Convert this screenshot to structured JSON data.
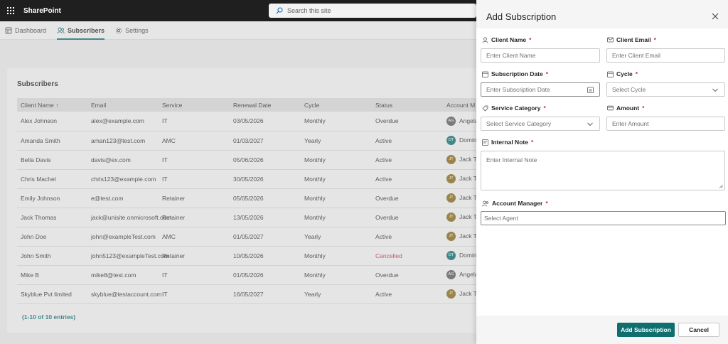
{
  "suite": {
    "brand": "SharePoint",
    "search_placeholder": "Search this site"
  },
  "nav": {
    "items": [
      {
        "label": "Dashboard"
      },
      {
        "label": "Subscribers"
      },
      {
        "label": "Settings"
      }
    ]
  },
  "subscribers": {
    "title": "Subscribers",
    "columns": [
      "Client Name ↑",
      "Email",
      "Service",
      "Renewal Date",
      "Cycle",
      "Status",
      "Account M"
    ],
    "rows": [
      {
        "name": "Alex Johnson",
        "email": "alex@example.com",
        "service": "IT",
        "renewal": "03/05/2026",
        "cycle": "Monthly",
        "status": "Overdue",
        "mgr_initials": "AG",
        "mgr": "Angela",
        "mgr_color": "#5c5c5c"
      },
      {
        "name": "Amanda Smith",
        "email": "aman123@test.com",
        "service": "AMC",
        "renewal": "01/03/2027",
        "cycle": "Yearly",
        "status": "Active",
        "mgr_initials": "DT",
        "mgr": "Domin",
        "mgr_color": "#0f6f6f"
      },
      {
        "name": "Bella Davis",
        "email": "davis@ex.com",
        "service": "IT",
        "renewal": "05/06/2026",
        "cycle": "Monthly",
        "status": "Active",
        "mgr_initials": "JT",
        "mgr": "Jack T",
        "mgr_color": "#8a6a1a"
      },
      {
        "name": "Chris Machel",
        "email": "chris123@example.com",
        "service": "IT",
        "renewal": "30/05/2026",
        "cycle": "Monthly",
        "status": "Active",
        "mgr_initials": "JT",
        "mgr": "Jack T",
        "mgr_color": "#8a6a1a"
      },
      {
        "name": "Emily Johnson",
        "email": "e@test.com",
        "service": "Retainer",
        "renewal": "05/05/2026",
        "cycle": "Monthly",
        "status": "Overdue",
        "mgr_initials": "JT",
        "mgr": "Jack T",
        "mgr_color": "#8a6a1a"
      },
      {
        "name": "Jack Thomas",
        "email": "jack@unisite.onmicrosoft.com",
        "service": "Retainer",
        "renewal": "13/05/2026",
        "cycle": "Monthly",
        "status": "Overdue",
        "mgr_initials": "JT",
        "mgr": "Jack T",
        "mgr_color": "#8a6a1a"
      },
      {
        "name": "John Doe",
        "email": "john@exampleTest.com",
        "service": "AMC",
        "renewal": "01/05/2027",
        "cycle": "Yearly",
        "status": "Active",
        "mgr_initials": "JT",
        "mgr": "Jack T",
        "mgr_color": "#8a6a1a"
      },
      {
        "name": "John Smith",
        "email": "john5123@exampleTest.com",
        "service": "Retainer",
        "renewal": "10/05/2026",
        "cycle": "Monthly",
        "status": "Cancelled",
        "mgr_initials": "DT",
        "mgr": "Domin",
        "mgr_color": "#0f6f6f"
      },
      {
        "name": "Mike B",
        "email": "mike8@test.com",
        "service": "IT",
        "renewal": "01/05/2026",
        "cycle": "Monthly",
        "status": "Overdue",
        "mgr_initials": "AG",
        "mgr": "Angela",
        "mgr_color": "#5c5c5c"
      },
      {
        "name": "Skyblue Pvt limited",
        "email": "skyblue@testaccount.com",
        "service": "IT",
        "renewal": "16/05/2027",
        "cycle": "Yearly",
        "status": "Active",
        "mgr_initials": "JT",
        "mgr": "Jack T",
        "mgr_color": "#8a6a1a"
      }
    ],
    "entries": "(1-10 of 10 entries)"
  },
  "panel": {
    "title": "Add Subscription",
    "required_mark": "*",
    "fields": {
      "client_name": {
        "label": "Client Name",
        "placeholder": "Enter Client Name"
      },
      "client_email": {
        "label": "Client Email",
        "placeholder": "Enter Client Email"
      },
      "subscription_date": {
        "label": "Subscription Date",
        "placeholder": "Enter Subscription Date"
      },
      "cycle": {
        "label": "Cycle",
        "placeholder": "Select Cycle"
      },
      "service_category": {
        "label": "Service Category",
        "placeholder": "Select Service Category"
      },
      "amount": {
        "label": "Amount",
        "placeholder": "Enter Amount"
      },
      "internal_note": {
        "label": "Internal Note",
        "placeholder": "Enter Internal Note"
      },
      "account_manager": {
        "label": "Account Manager",
        "placeholder": "Select Agent"
      }
    },
    "submit_label": "Add Subscription",
    "cancel_label": "Cancel"
  },
  "colors": {
    "accent": "#0f6f6f",
    "required": "#c4314b",
    "suite_bar": "#1f1f1f"
  }
}
